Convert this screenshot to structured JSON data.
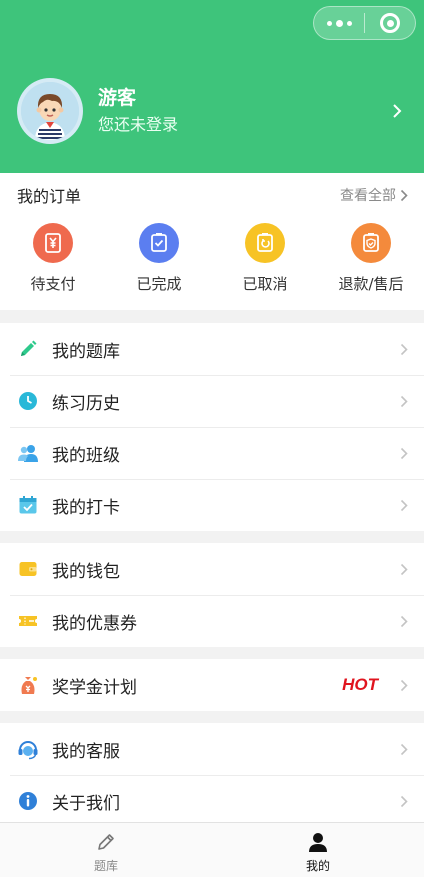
{
  "header": {
    "bg_color": "#3ec47b",
    "capsule": {
      "more_icon": "more-dots-icon",
      "close_icon": "target-icon"
    },
    "profile": {
      "name": "游客",
      "subtitle": "您还未登录"
    }
  },
  "orders": {
    "title": "我的订单",
    "view_all": "查看全部",
    "items": [
      {
        "label": "待支付",
        "icon": "yuan-receipt-icon",
        "color": "#ef6a4e"
      },
      {
        "label": "已完成",
        "icon": "check-clipboard-icon",
        "color": "#5b7ef0"
      },
      {
        "label": "已取消",
        "icon": "cancel-clipboard-icon",
        "color": "#f7c325"
      },
      {
        "label": "退款/售后",
        "icon": "refund-shield-icon",
        "color": "#f48a3c"
      }
    ]
  },
  "menu": {
    "group1": [
      {
        "label": "我的题库",
        "icon": "pencil-icon"
      },
      {
        "label": "练习历史",
        "icon": "clock-icon"
      },
      {
        "label": "我的班级",
        "icon": "people-icon"
      },
      {
        "label": "我的打卡",
        "icon": "calendar-check-icon"
      }
    ],
    "group2": [
      {
        "label": "我的钱包",
        "icon": "wallet-icon"
      },
      {
        "label": "我的优惠券",
        "icon": "coupon-icon"
      }
    ],
    "group3": [
      {
        "label": "奖学金计划",
        "icon": "money-bag-icon",
        "badge": "HOT"
      }
    ],
    "group4": [
      {
        "label": "我的客服",
        "icon": "headset-icon"
      },
      {
        "label": "关于我们",
        "icon": "info-icon"
      }
    ]
  },
  "tabbar": {
    "tabs": [
      {
        "label": "题库",
        "icon": "pencil-outline-icon",
        "active": false
      },
      {
        "label": "我的",
        "icon": "person-icon",
        "active": true
      }
    ]
  }
}
